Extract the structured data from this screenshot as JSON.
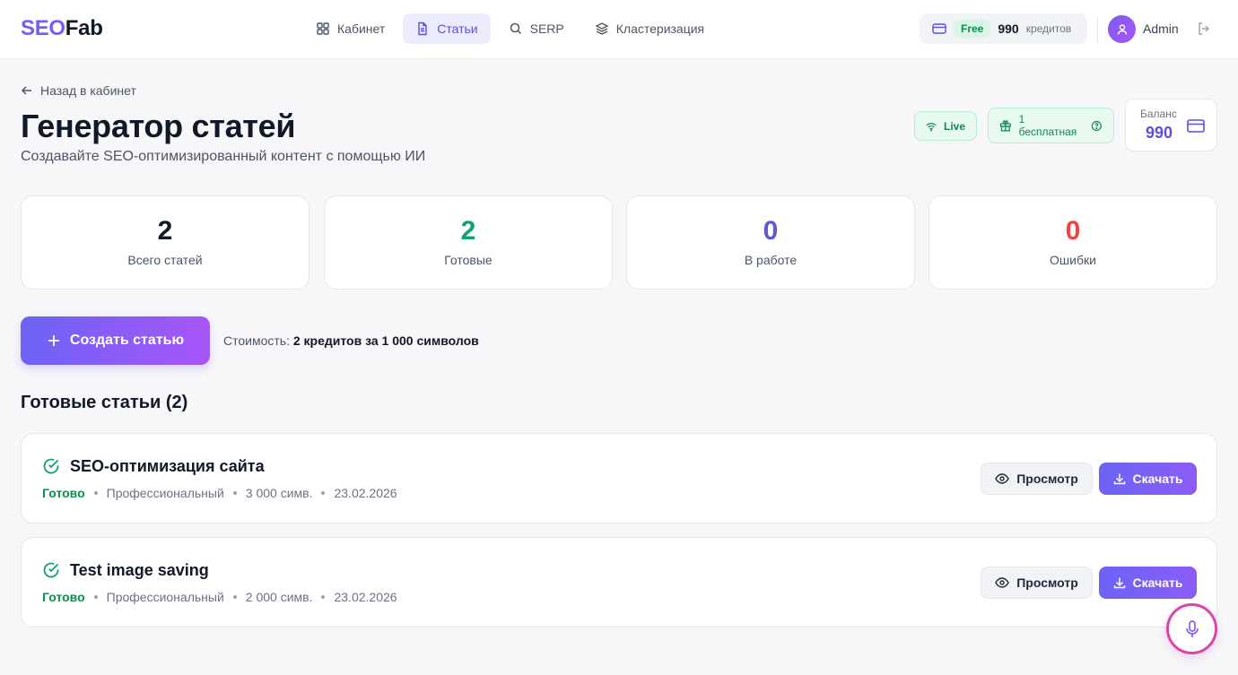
{
  "header": {
    "logo_seo": "SEO",
    "logo_fab": "Fab",
    "nav": [
      {
        "label": "Кабинет",
        "icon": "grid-icon"
      },
      {
        "label": "Статьи",
        "icon": "document-icon",
        "active": true
      },
      {
        "label": "SERP",
        "icon": "search-icon"
      },
      {
        "label": "Кластеризация",
        "icon": "layers-icon"
      }
    ],
    "plan_badge": "Free",
    "credits_value": "990",
    "credits_label": "кредитов",
    "user_name": "Admin"
  },
  "page": {
    "back_label": "Назад в кабинет",
    "title": "Генератор статей",
    "subtitle": "Создавайте SEO-оптимизированный контент с помощью ИИ",
    "live_label": "Live",
    "free_label": "1 бесплатная",
    "balance_label": "Баланс",
    "balance_value": "990"
  },
  "stats": [
    {
      "value": "2",
      "label": "Всего статей",
      "color": "#111827"
    },
    {
      "value": "2",
      "label": "Готовые",
      "color": "#10a36b"
    },
    {
      "value": "0",
      "label": "В работе",
      "color": "#5b5bd6"
    },
    {
      "value": "0",
      "label": "Ошибки",
      "color": "#ef4444"
    }
  ],
  "actions": {
    "create_label": "Создать статью",
    "cost_prefix": "Стоимость:",
    "cost_value": "2 кредитов за 1 000 символов"
  },
  "section_title": "Готовые статьи (2)",
  "articles": [
    {
      "title": "SEO-оптимизация сайта",
      "status": "Готово",
      "style": "Профессиональный",
      "chars": "3 000 симв.",
      "date": "23.02.2026",
      "view_label": "Просмотр",
      "download_label": "Скачать"
    },
    {
      "title": "Test image saving",
      "status": "Готово",
      "style": "Профессиональный",
      "chars": "2 000 симв.",
      "date": "23.02.2026",
      "view_label": "Просмотр",
      "download_label": "Скачать"
    }
  ],
  "colors": {
    "accent": "#7c5cf0",
    "success": "#0f8a50",
    "error": "#ef4444"
  }
}
